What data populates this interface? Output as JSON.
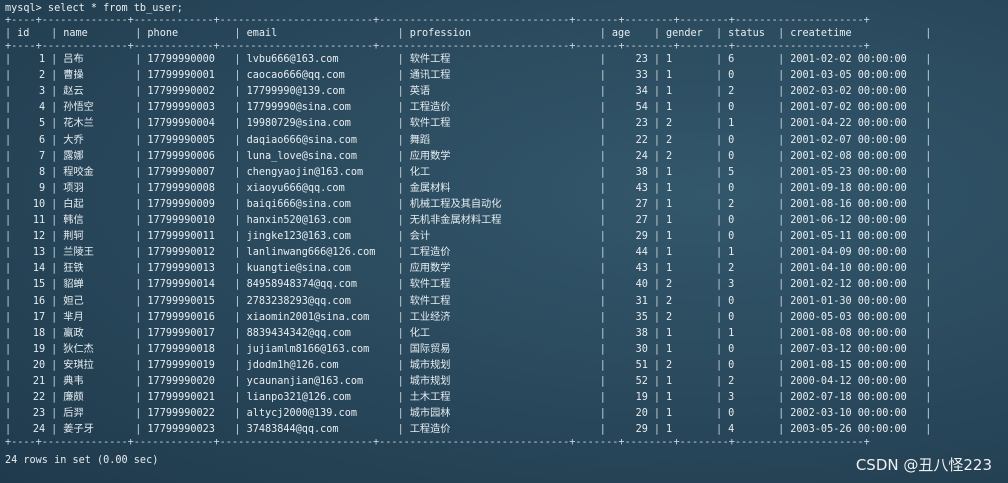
{
  "prompt": "mysql> select * from tb_user;",
  "border_line": "+----+--------------+-------------+-------------------------+-------------------------------+-------+--------+--------+---------------------+",
  "columns": [
    "id",
    "name",
    "phone",
    "email",
    "profession",
    "age",
    "gender",
    "status",
    "createtime"
  ],
  "rows": [
    {
      "id": "1",
      "name": "吕布",
      "phone": "17799990000",
      "email": "lvbu666@163.com",
      "profession": "软件工程",
      "age": "23",
      "gender": "1",
      "status": "6",
      "createtime": "2001-02-02 00:00:00"
    },
    {
      "id": "2",
      "name": "曹操",
      "phone": "17799990001",
      "email": "caocao666@qq.com",
      "profession": "通讯工程",
      "age": "33",
      "gender": "1",
      "status": "0",
      "createtime": "2001-03-05 00:00:00"
    },
    {
      "id": "3",
      "name": "赵云",
      "phone": "17799990002",
      "email": "17799990@139.com",
      "profession": "英语",
      "age": "34",
      "gender": "1",
      "status": "2",
      "createtime": "2002-03-02 00:00:00"
    },
    {
      "id": "4",
      "name": "孙悟空",
      "phone": "17799990003",
      "email": "17799990@sina.com",
      "profession": "工程造价",
      "age": "54",
      "gender": "1",
      "status": "0",
      "createtime": "2001-07-02 00:00:00"
    },
    {
      "id": "5",
      "name": "花木兰",
      "phone": "17799990004",
      "email": "19980729@sina.com",
      "profession": "软件工程",
      "age": "23",
      "gender": "2",
      "status": "1",
      "createtime": "2001-04-22 00:00:00"
    },
    {
      "id": "6",
      "name": "大乔",
      "phone": "17799990005",
      "email": "daqiao666@sina.com",
      "profession": "舞蹈",
      "age": "22",
      "gender": "2",
      "status": "0",
      "createtime": "2001-02-07 00:00:00"
    },
    {
      "id": "7",
      "name": "露娜",
      "phone": "17799990006",
      "email": "luna_love@sina.com",
      "profession": "应用数学",
      "age": "24",
      "gender": "2",
      "status": "0",
      "createtime": "2001-02-08 00:00:00"
    },
    {
      "id": "8",
      "name": "程咬金",
      "phone": "17799990007",
      "email": "chengyaojin@163.com",
      "profession": "化工",
      "age": "38",
      "gender": "1",
      "status": "5",
      "createtime": "2001-05-23 00:00:00"
    },
    {
      "id": "9",
      "name": "项羽",
      "phone": "17799990008",
      "email": "xiaoyu666@qq.com",
      "profession": "金属材料",
      "age": "43",
      "gender": "1",
      "status": "0",
      "createtime": "2001-09-18 00:00:00"
    },
    {
      "id": "10",
      "name": "白起",
      "phone": "17799990009",
      "email": "baiqi666@sina.com",
      "profession": "机械工程及其自动化",
      "age": "27",
      "gender": "1",
      "status": "2",
      "createtime": "2001-08-16 00:00:00"
    },
    {
      "id": "11",
      "name": "韩信",
      "phone": "17799990010",
      "email": "hanxin520@163.com",
      "profession": "无机非金属材料工程",
      "age": "27",
      "gender": "1",
      "status": "0",
      "createtime": "2001-06-12 00:00:00"
    },
    {
      "id": "12",
      "name": "荆轲",
      "phone": "17799990011",
      "email": "jingke123@163.com",
      "profession": "会计",
      "age": "29",
      "gender": "1",
      "status": "0",
      "createtime": "2001-05-11 00:00:00"
    },
    {
      "id": "13",
      "name": "兰陵王",
      "phone": "17799990012",
      "email": "lanlinwang666@126.com",
      "profession": "工程造价",
      "age": "44",
      "gender": "1",
      "status": "1",
      "createtime": "2001-04-09 00:00:00"
    },
    {
      "id": "14",
      "name": "狂铁",
      "phone": "17799990013",
      "email": "kuangtie@sina.com",
      "profession": "应用数学",
      "age": "43",
      "gender": "1",
      "status": "2",
      "createtime": "2001-04-10 00:00:00"
    },
    {
      "id": "15",
      "name": "貂蝉",
      "phone": "17799990014",
      "email": "84958948374@qq.com",
      "profession": "软件工程",
      "age": "40",
      "gender": "2",
      "status": "3",
      "createtime": "2001-02-12 00:00:00"
    },
    {
      "id": "16",
      "name": "妲己",
      "phone": "17799990015",
      "email": "2783238293@qq.com",
      "profession": "软件工程",
      "age": "31",
      "gender": "2",
      "status": "0",
      "createtime": "2001-01-30 00:00:00"
    },
    {
      "id": "17",
      "name": "芈月",
      "phone": "17799990016",
      "email": "xiaomin2001@sina.com",
      "profession": "工业经济",
      "age": "35",
      "gender": "2",
      "status": "0",
      "createtime": "2000-05-03 00:00:00"
    },
    {
      "id": "18",
      "name": "嬴政",
      "phone": "17799990017",
      "email": "8839434342@qq.com",
      "profession": "化工",
      "age": "38",
      "gender": "1",
      "status": "1",
      "createtime": "2001-08-08 00:00:00"
    },
    {
      "id": "19",
      "name": "狄仁杰",
      "phone": "17799990018",
      "email": "jujiamlm8166@163.com",
      "profession": "国际贸易",
      "age": "30",
      "gender": "1",
      "status": "0",
      "createtime": "2007-03-12 00:00:00"
    },
    {
      "id": "20",
      "name": "安琪拉",
      "phone": "17799990019",
      "email": "jdodm1h@126.com",
      "profession": "城市规划",
      "age": "51",
      "gender": "2",
      "status": "0",
      "createtime": "2001-08-15 00:00:00"
    },
    {
      "id": "21",
      "name": "典韦",
      "phone": "17799990020",
      "email": "ycaunanjian@163.com",
      "profession": "城市规划",
      "age": "52",
      "gender": "1",
      "status": "2",
      "createtime": "2000-04-12 00:00:00"
    },
    {
      "id": "22",
      "name": "廉颇",
      "phone": "17799990021",
      "email": "lianpo321@126.com",
      "profession": "土木工程",
      "age": "19",
      "gender": "1",
      "status": "3",
      "createtime": "2002-07-18 00:00:00"
    },
    {
      "id": "23",
      "name": "后羿",
      "phone": "17799990022",
      "email": "altycj2000@139.com",
      "profession": "城市园林",
      "age": "20",
      "gender": "1",
      "status": "0",
      "createtime": "2002-03-10 00:00:00"
    },
    {
      "id": "24",
      "name": "姜子牙",
      "phone": "17799990023",
      "email": "37483844@qq.com",
      "profession": "工程造价",
      "age": "29",
      "gender": "1",
      "status": "4",
      "createtime": "2003-05-26 00:00:00"
    }
  ],
  "footer": "24 rows in set (0.00 sec)",
  "watermark": "CSDN @丑八怪223",
  "colors": {
    "background": "#2b4a5e",
    "text": "#e6edf1"
  }
}
